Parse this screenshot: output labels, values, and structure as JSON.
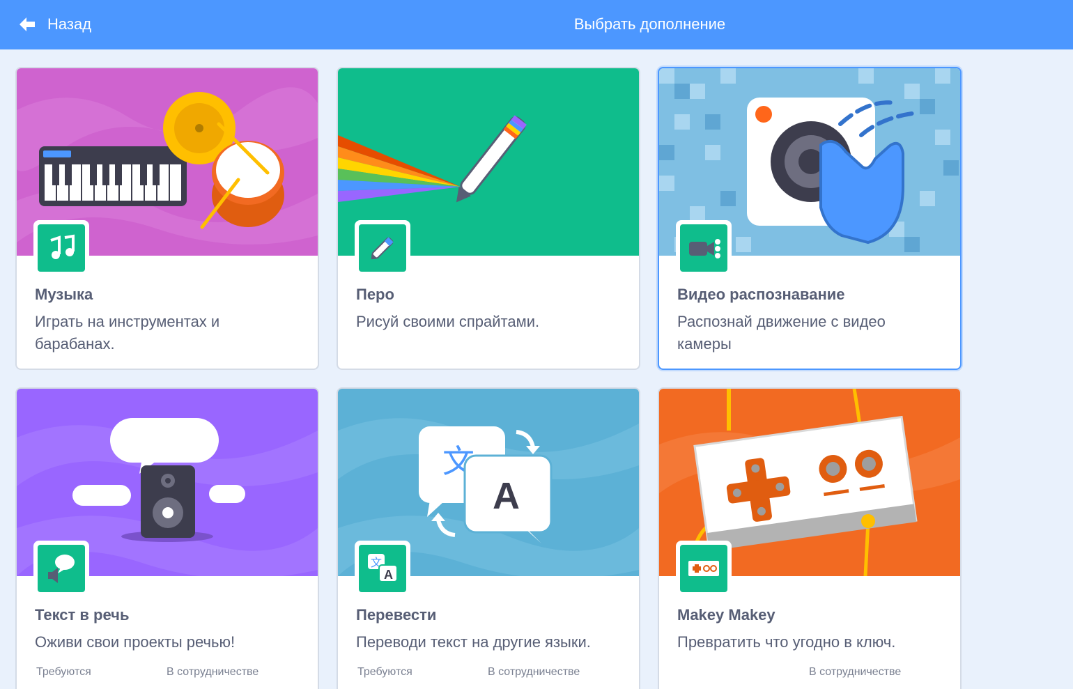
{
  "header": {
    "back_label": "Назад",
    "title": "Выбрать дополнение"
  },
  "extensions": [
    {
      "name": "Музыка",
      "description": "Играть на инструментах и барабанах.",
      "banner_color": "#cf63cf",
      "icon": "music-notes-icon"
    },
    {
      "name": "Перо",
      "description": "Рисуй своими спрайтами.",
      "banner_color": "#0fbd8c",
      "icon": "pen-icon"
    },
    {
      "name": "Видео распознавание",
      "description": "Распознай движение с видео камеры",
      "banner_color": "#7fbfe3",
      "icon": "video-camera-icon",
      "selected": true
    },
    {
      "name": "Текст в речь",
      "description": "Оживи свои проекты речью!",
      "banner_color": "#9966ff",
      "icon": "speech-bubble-speaker-icon",
      "requires_label": "Требуются",
      "collab_label": "В сотрудничестве"
    },
    {
      "name": "Перевести",
      "description": "Переводи текст на другие языки.",
      "banner_color": "#5cb1d6",
      "icon": "translate-icon",
      "requires_label": "Требуются",
      "collab_label": "В сотрудничестве"
    },
    {
      "name": "Makey Makey",
      "description": "Превратить что угодно в ключ.",
      "banner_color": "#f26a22",
      "icon": "makey-makey-board-icon",
      "collab_label": "В сотрудничестве"
    }
  ]
}
